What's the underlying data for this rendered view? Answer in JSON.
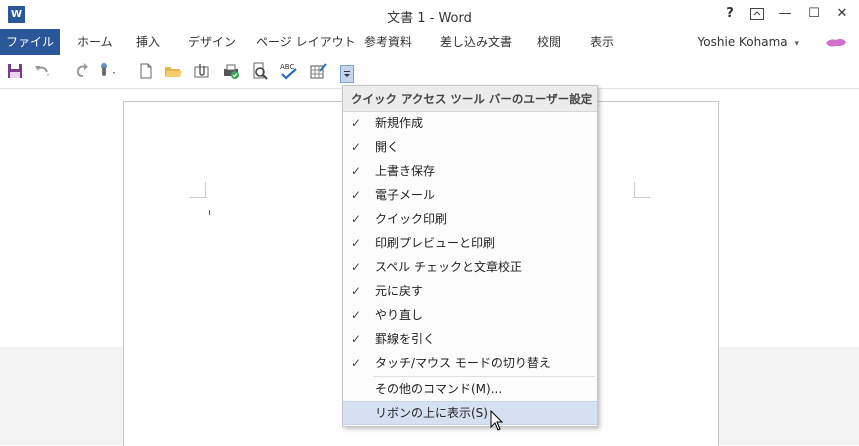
{
  "window": {
    "title": "文書 1 - Word",
    "logo_text": "W",
    "buttons": [
      "?",
      "⧉",
      "—",
      "☐",
      "✕"
    ]
  },
  "ribbon": {
    "tabs": [
      "ファイル",
      "ホーム",
      "挿入",
      "デザイン",
      "ページ レイアウト",
      "参考資料",
      "差し込み文書",
      "校閲",
      "表示"
    ],
    "user": "Yoshie Kohama",
    "user_caret": "▾"
  },
  "qat": {
    "icons": [
      "save-icon",
      "undo-icon",
      "redo-icon",
      "touch-mode-icon",
      "new-document-icon",
      "open-folder-icon",
      "email-attach-icon",
      "quick-print-icon",
      "print-preview-icon",
      "spelling-check-icon",
      "draw-table-icon",
      "customize-dropdown-icon"
    ]
  },
  "menu": {
    "header": "クイック アクセス ツール バーのユーザー設定",
    "items": [
      {
        "label": "新規作成",
        "checked": "✓"
      },
      {
        "label": "開く",
        "checked": "✓"
      },
      {
        "label": "上書き保存",
        "checked": "✓"
      },
      {
        "label": "電子メール",
        "checked": "✓"
      },
      {
        "label": "クイック印刷",
        "checked": "✓"
      },
      {
        "label": "印刷プレビューと印刷",
        "checked": "✓"
      },
      {
        "label": "スペル チェックと文章校正",
        "checked": "✓"
      },
      {
        "label": "元に戻す",
        "checked": "✓"
      },
      {
        "label": "やり直し",
        "checked": "✓"
      },
      {
        "label": "罫線を引く",
        "checked": "✓"
      },
      {
        "label": "タッチ/マウス モードの切り替え",
        "checked": "✓"
      }
    ],
    "more_commands": "その他のコマンド(M)...",
    "show_above_ribbon": "リボンの上に表示(S)"
  },
  "colors": {
    "accent": "#2b579a",
    "highlight": "#d5e1f2"
  }
}
